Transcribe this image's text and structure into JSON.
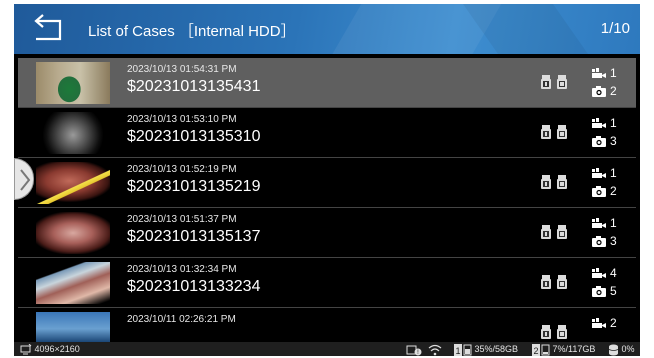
{
  "header": {
    "back_icon": "back-arrow-icon",
    "title": "List of Cases ［Internal HDD］",
    "page_indicator": "1/10"
  },
  "rows": [
    {
      "date": "2023/10/13 01:54:31 PM",
      "case_id": "$20231013135431",
      "videos": "1",
      "images": "2",
      "selected": true
    },
    {
      "date": "2023/10/13 01:53:10 PM",
      "case_id": "$20231013135310",
      "videos": "1",
      "images": "3",
      "selected": false
    },
    {
      "date": "2023/10/13 01:52:19 PM",
      "case_id": "$20231013135219",
      "videos": "1",
      "images": "2",
      "selected": false
    },
    {
      "date": "2023/10/13 01:51:37 PM",
      "case_id": "$20231013135137",
      "videos": "1",
      "images": "3",
      "selected": false
    },
    {
      "date": "2023/10/13 01:32:34 PM",
      "case_id": "$20231013133234",
      "videos": "4",
      "images": "5",
      "selected": false
    },
    {
      "date": "2023/10/11 02:26:21 PM",
      "case_id": "",
      "videos": "2",
      "images": "",
      "selected": false
    }
  ],
  "status_bar": {
    "resolution": "4096×2160",
    "storage1": "35%/58GB",
    "storage2": "7%/117GB",
    "drive_usage": "0%",
    "storage1_badge": "1",
    "storage2_badge": "2"
  },
  "colors": {
    "header_blue": "#2b74b8",
    "selected_row": "#5f5f5f",
    "status_bar": "#1f1f1f"
  }
}
